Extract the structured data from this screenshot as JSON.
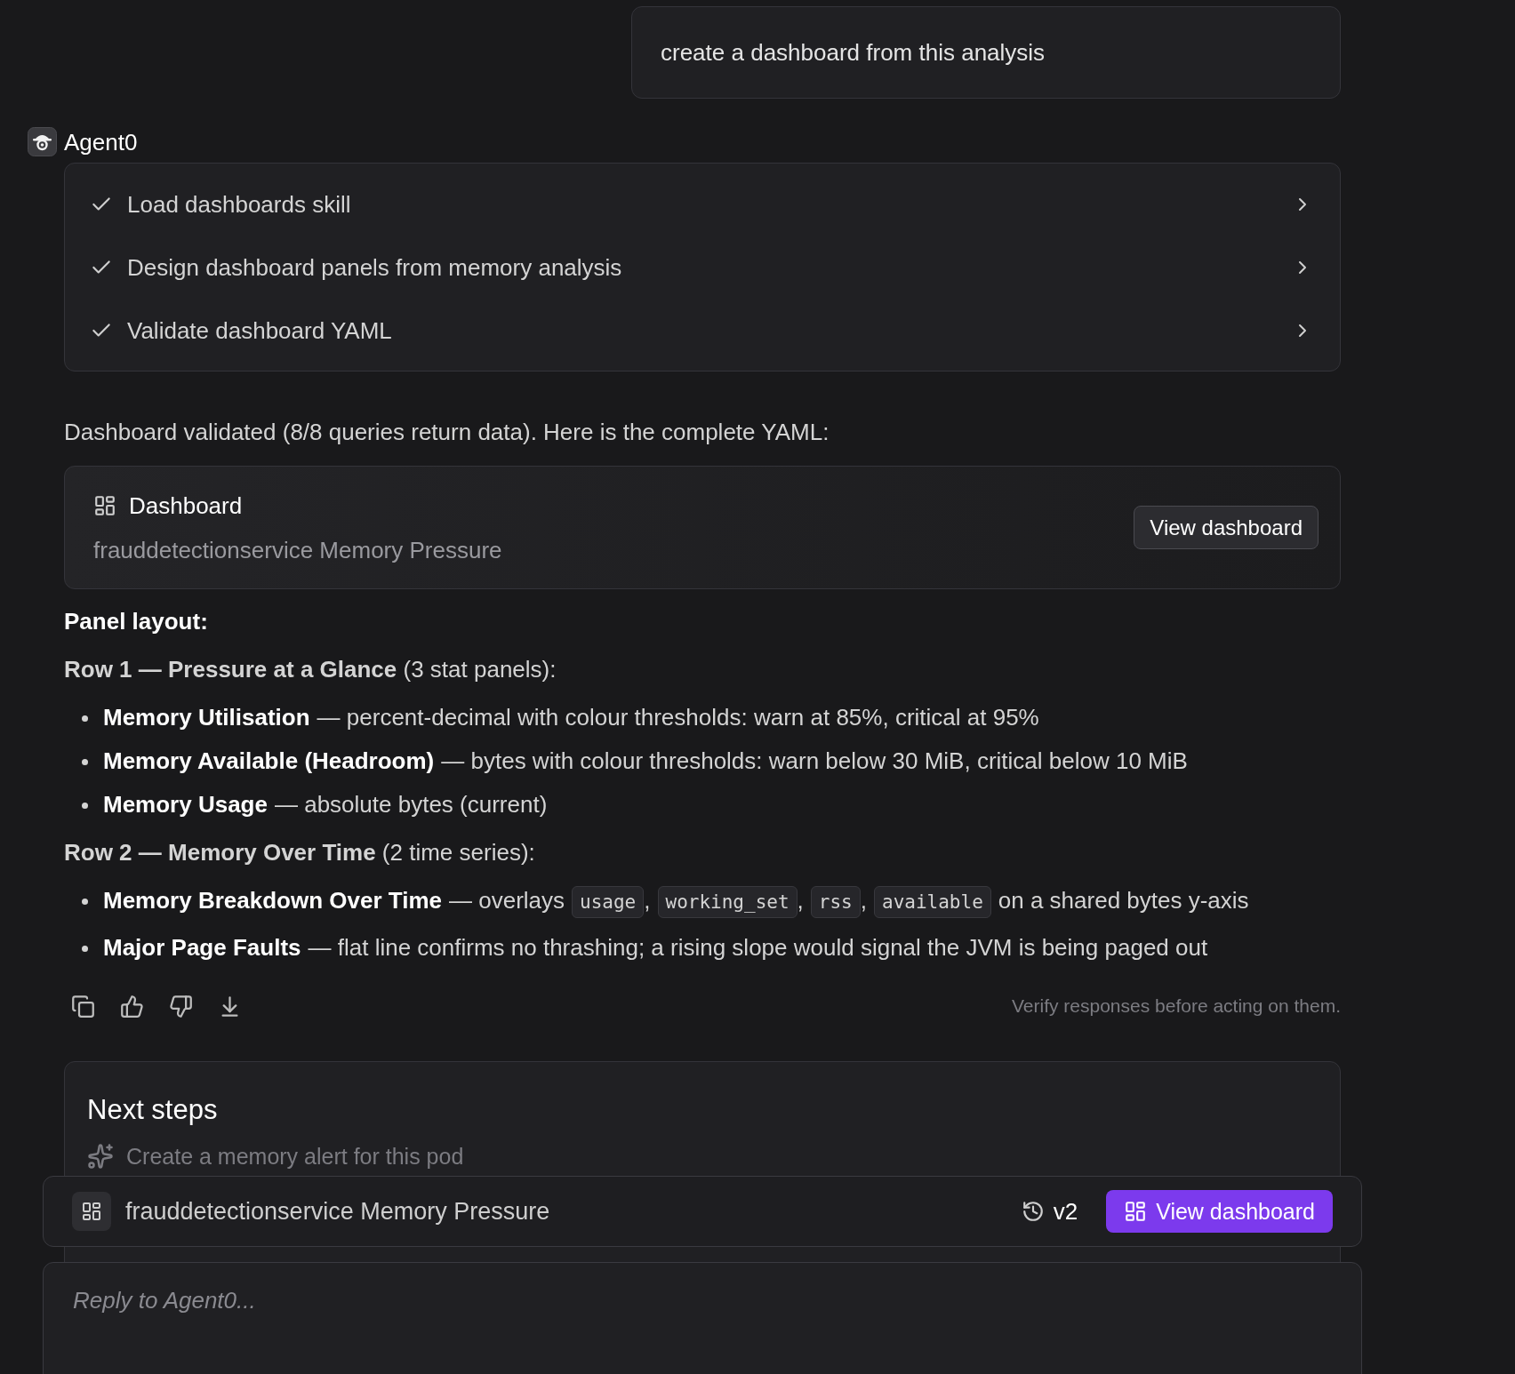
{
  "user_message": "create a dashboard from this analysis",
  "agent": {
    "name": "Agent0"
  },
  "steps": [
    {
      "label": "Load dashboards skill",
      "checked": true
    },
    {
      "label": "Design dashboard panels from memory analysis",
      "checked": true
    },
    {
      "label": "Validate dashboard YAML",
      "checked": true
    }
  ],
  "intro": "Dashboard validated (8/8 queries return data). Here is the complete YAML:",
  "dashboard_card": {
    "title": "Dashboard",
    "subtitle": "frauddetectionservice Memory Pressure",
    "button": "View dashboard"
  },
  "panel_layout": {
    "heading": "Panel layout:",
    "rows": [
      {
        "heading": "**Row 1 — Pressure at a Glance** (3 stat panels):",
        "bullets": [
          {
            "title": "Memory Utilisation",
            "segments": [
              {
                "kind": "text",
                "text": "— percent-decimal with colour thresholds: warn at 85%, critical at 95%"
              }
            ]
          },
          {
            "title": "Memory Available (Headroom)",
            "segments": [
              {
                "kind": "text",
                "text": "— bytes with colour thresholds: warn below 30 MiB, critical below 10 MiB"
              }
            ]
          },
          {
            "title": "Memory Usage",
            "segments": [
              {
                "kind": "text",
                "text": "— absolute bytes (current)"
              }
            ]
          }
        ]
      },
      {
        "heading": "**Row 2 — Memory Over Time** (2 time series):",
        "bullets": [
          {
            "title": "Memory Breakdown Over Time",
            "segments": [
              {
                "kind": "text",
                "text": "— overlays"
              },
              {
                "kind": "code",
                "text": "usage"
              },
              {
                "kind": "text",
                "text": ","
              },
              {
                "kind": "code",
                "text": "working_set"
              },
              {
                "kind": "text",
                "text": ","
              },
              {
                "kind": "code",
                "text": "rss"
              },
              {
                "kind": "text",
                "text": ","
              },
              {
                "kind": "code",
                "text": "available"
              },
              {
                "kind": "text",
                "text": "on a shared bytes y-axis"
              }
            ]
          },
          {
            "title": "Major Page Faults",
            "segments": [
              {
                "kind": "text",
                "text": "— flat line confirms no thrashing; a rising slope would signal the JVM is being paged out"
              }
            ]
          }
        ]
      }
    ]
  },
  "disclaimer": "Verify responses before acting on them.",
  "next_steps": {
    "title": "Next steps",
    "items": [
      {
        "label": "Create a memory alert for this pod"
      }
    ]
  },
  "dashboard_bar": {
    "title": "frauddetectionservice Memory Pressure",
    "version": "v2",
    "button": "View dashboard"
  },
  "reply": {
    "placeholder": "Reply to Agent0..."
  }
}
